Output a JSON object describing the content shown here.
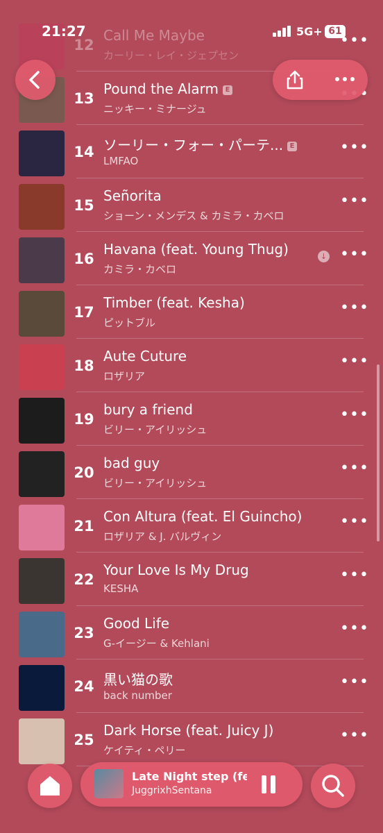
{
  "status_bar": {
    "time": "21:27",
    "network": "5G+",
    "battery": "61"
  },
  "header": {
    "back_icon": "chevron-left-icon",
    "share_icon": "share-icon",
    "more_icon": "ellipsis-icon"
  },
  "tracks": [
    {
      "number": "12",
      "title": "Call Me Maybe",
      "artist": "カーリー・レイ・ジェプセン",
      "explicit": false,
      "downloaded": false,
      "faded": true
    },
    {
      "number": "13",
      "title": "Pound the Alarm",
      "artist": "ニッキー・ミナージュ",
      "explicit": true,
      "downloaded": false,
      "faded": false
    },
    {
      "number": "14",
      "title": "ソーリー・フォー・パーテ...",
      "artist": "LMFAO",
      "explicit": true,
      "downloaded": false,
      "faded": false
    },
    {
      "number": "15",
      "title": "Señorita",
      "artist": "ショーン・メンデス & カミラ・カベロ",
      "explicit": false,
      "downloaded": false,
      "faded": false
    },
    {
      "number": "16",
      "title": "Havana (feat. Young Thug)",
      "artist": "カミラ・カベロ",
      "explicit": false,
      "downloaded": true,
      "faded": false
    },
    {
      "number": "17",
      "title": "Timber (feat. Kesha)",
      "artist": "ピットブル",
      "explicit": false,
      "downloaded": false,
      "faded": false
    },
    {
      "number": "18",
      "title": "Aute Cuture",
      "artist": "ロザリア",
      "explicit": false,
      "downloaded": false,
      "faded": false
    },
    {
      "number": "19",
      "title": "bury a friend",
      "artist": "ビリー・アイリッシュ",
      "explicit": false,
      "downloaded": false,
      "faded": false
    },
    {
      "number": "20",
      "title": "bad guy",
      "artist": "ビリー・アイリッシュ",
      "explicit": false,
      "downloaded": false,
      "faded": false
    },
    {
      "number": "21",
      "title": "Con Altura (feat. El Guincho)",
      "artist": "ロザリア & J. バルヴィン",
      "explicit": false,
      "downloaded": false,
      "faded": false
    },
    {
      "number": "22",
      "title": "Your Love Is My Drug",
      "artist": "KESHA",
      "explicit": false,
      "downloaded": false,
      "faded": false
    },
    {
      "number": "23",
      "title": "Good Life",
      "artist": "G-イージー & Kehlani",
      "explicit": false,
      "downloaded": false,
      "faded": false
    },
    {
      "number": "24",
      "title": "黒い猫の歌",
      "artist": "back number",
      "explicit": false,
      "downloaded": false,
      "faded": false
    },
    {
      "number": "25",
      "title": "Dark Horse (feat. Juicy J)",
      "artist": "ケイティ・ペリー",
      "explicit": false,
      "downloaded": false,
      "faded": false
    }
  ],
  "artwork_colors": [
    "#c23a5a",
    "#7a5a50",
    "#2a2540",
    "#8a3a2a",
    "#4a3a4a",
    "#5a4a3a",
    "#c94050",
    "#1c1c1c",
    "#222",
    "#e07a9a",
    "#3a3530",
    "#4a6a8a",
    "#0a1a3a",
    "#d8c0b0"
  ],
  "explicit_badge": "E",
  "now_playing": {
    "title": "Late Night step (feat",
    "artist": "JuggrixhSentana"
  },
  "bottom_bar": {
    "home_icon": "home-icon",
    "pause_icon": "pause-icon",
    "search_icon": "search-icon"
  }
}
